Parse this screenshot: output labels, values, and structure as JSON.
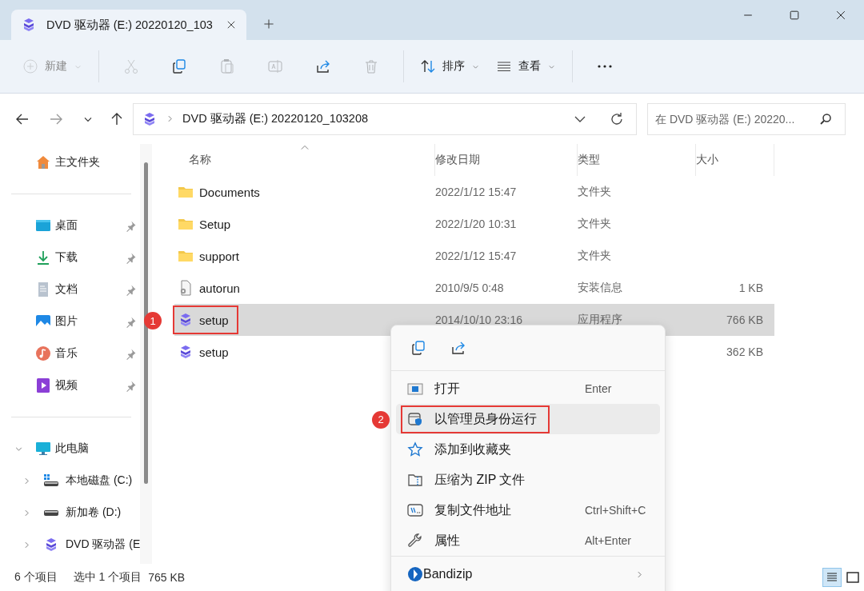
{
  "window": {
    "tabs": [
      {
        "title": "DVD 驱动器 (E:) 20220120_103",
        "kind": "dvd",
        "selected": true
      }
    ]
  },
  "toolbar": [
    {
      "kind": "new",
      "label": "新建",
      "dropdown": true,
      "disabled": true
    },
    {
      "kind": "cut",
      "disabled": true
    },
    {
      "kind": "copy",
      "disabled": false
    },
    {
      "kind": "paste",
      "disabled": true
    },
    {
      "kind": "rename",
      "disabled": true
    },
    {
      "kind": "share",
      "disabled": false
    },
    {
      "kind": "delete",
      "disabled": true
    },
    {
      "kind": "sort",
      "label": "排序",
      "dropdown": true,
      "disabled": false
    },
    {
      "kind": "view",
      "label": "查看",
      "dropdown": true,
      "disabled": false
    },
    {
      "kind": "more",
      "disabled": false
    }
  ],
  "address": {
    "path": "DVD 驱动器 (E:) 20220120_103208",
    "search_placeholder": "在 DVD 驱动器 (E:) 20220..."
  },
  "sidebar": {
    "home": {
      "label": "主文件夹",
      "kind": "home"
    },
    "pinned": [
      {
        "label": "桌面",
        "kind": "desktop"
      },
      {
        "label": "下载",
        "kind": "download"
      },
      {
        "label": "文档",
        "kind": "document"
      },
      {
        "label": "图片",
        "kind": "pictures"
      },
      {
        "label": "音乐",
        "kind": "music"
      },
      {
        "label": "视频",
        "kind": "videos"
      }
    ],
    "tree": [
      {
        "label": "此电脑",
        "kind": "pc",
        "expanded": true,
        "children": [
          {
            "label": "本地磁盘 (C:)",
            "kind": "windisk",
            "expanded": false
          },
          {
            "label": "新加卷 (D:)",
            "kind": "disk",
            "expanded": false
          },
          {
            "label": "DVD 驱动器 (E",
            "kind": "dvd",
            "expanded": false
          }
        ]
      }
    ]
  },
  "table": {
    "columns": [
      {
        "label": "名称",
        "sorted": true
      },
      {
        "label": "修改日期",
        "sorted": false
      },
      {
        "label": "类型",
        "sorted": false
      },
      {
        "label": "大小",
        "sorted": false
      }
    ],
    "rows": [
      {
        "name": "Documents",
        "kind": "folder",
        "modified": "2022/1/12 15:47",
        "type": "文件夹",
        "size": "",
        "selected": false
      },
      {
        "name": "Setup",
        "kind": "folder",
        "modified": "2022/1/20 10:31",
        "type": "文件夹",
        "size": "",
        "selected": false
      },
      {
        "name": "support",
        "kind": "folder",
        "modified": "2022/1/12 15:47",
        "type": "文件夹",
        "size": "",
        "selected": false
      },
      {
        "name": "autorun",
        "kind": "settingsfile",
        "modified": "2010/9/5 0:48",
        "type": "安装信息",
        "size": "1 KB",
        "selected": false
      },
      {
        "name": "setup",
        "kind": "dvd",
        "modified": "2014/10/10 23:16",
        "type": "应用程序",
        "size": "766 KB",
        "selected": true,
        "annotation": "1"
      },
      {
        "name": "setup",
        "kind": "dvd",
        "size": "362 KB",
        "selected": false
      }
    ]
  },
  "context_menu": {
    "quick_actions": [
      {
        "kind": "copy"
      },
      {
        "kind": "share"
      }
    ],
    "items": [
      {
        "kind": "open",
        "label": "打开",
        "shortcut": "Enter",
        "hovered": false
      },
      {
        "kind": "admin",
        "label": "以管理员身份运行",
        "hovered": true,
        "annotation": "2"
      },
      {
        "kind": "star",
        "label": "添加到收藏夹",
        "hovered": false
      },
      {
        "kind": "zip",
        "label": "压缩为 ZIP 文件",
        "hovered": false
      },
      {
        "kind": "path",
        "label": "复制文件地址",
        "shortcut": "Ctrl+Shift+C",
        "hovered": false
      },
      {
        "kind": "wrench",
        "label": "属性",
        "shortcut": "Alt+Enter",
        "hovered": false
      }
    ],
    "extra_items": [
      {
        "kind": "bandizip",
        "label": "Bandizip",
        "submenu": true,
        "hovered": false
      }
    ]
  },
  "status_bar": {
    "count": "6 个项目",
    "selection": "选中 1 个项目",
    "size": "765 KB",
    "views": [
      {
        "kind": "details",
        "selected": true
      },
      {
        "kind": "tiles",
        "selected": false
      }
    ]
  }
}
